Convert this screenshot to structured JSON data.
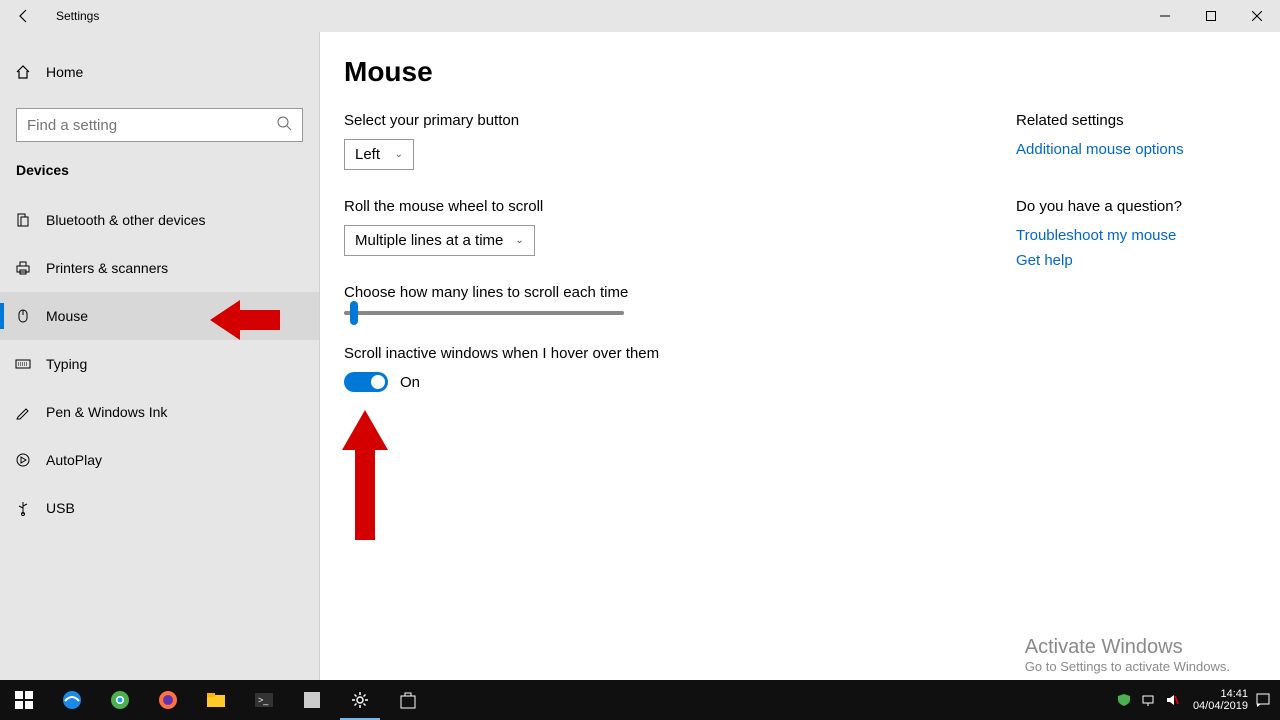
{
  "window": {
    "title": "Settings"
  },
  "sidebar": {
    "home": "Home",
    "search_placeholder": "Find a setting",
    "category": "Devices",
    "items": [
      {
        "label": "Bluetooth & other devices"
      },
      {
        "label": "Printers & scanners"
      },
      {
        "label": "Mouse"
      },
      {
        "label": "Typing"
      },
      {
        "label": "Pen & Windows Ink"
      },
      {
        "label": "AutoPlay"
      },
      {
        "label": "USB"
      }
    ]
  },
  "page": {
    "title": "Mouse",
    "primary_button_label": "Select your primary button",
    "primary_button_value": "Left",
    "scroll_wheel_label": "Roll the mouse wheel to scroll",
    "scroll_wheel_value": "Multiple lines at a time",
    "lines_label": "Choose how many lines to scroll each time",
    "inactive_label": "Scroll inactive windows when I hover over them",
    "inactive_state": "On"
  },
  "related": {
    "heading": "Related settings",
    "link1": "Additional mouse options",
    "question": "Do you have a question?",
    "link2": "Troubleshoot my mouse",
    "link3": "Get help"
  },
  "watermark": {
    "line1": "Activate Windows",
    "line2": "Go to Settings to activate Windows."
  },
  "tray": {
    "time": "14:41",
    "date": "04/04/2019"
  }
}
